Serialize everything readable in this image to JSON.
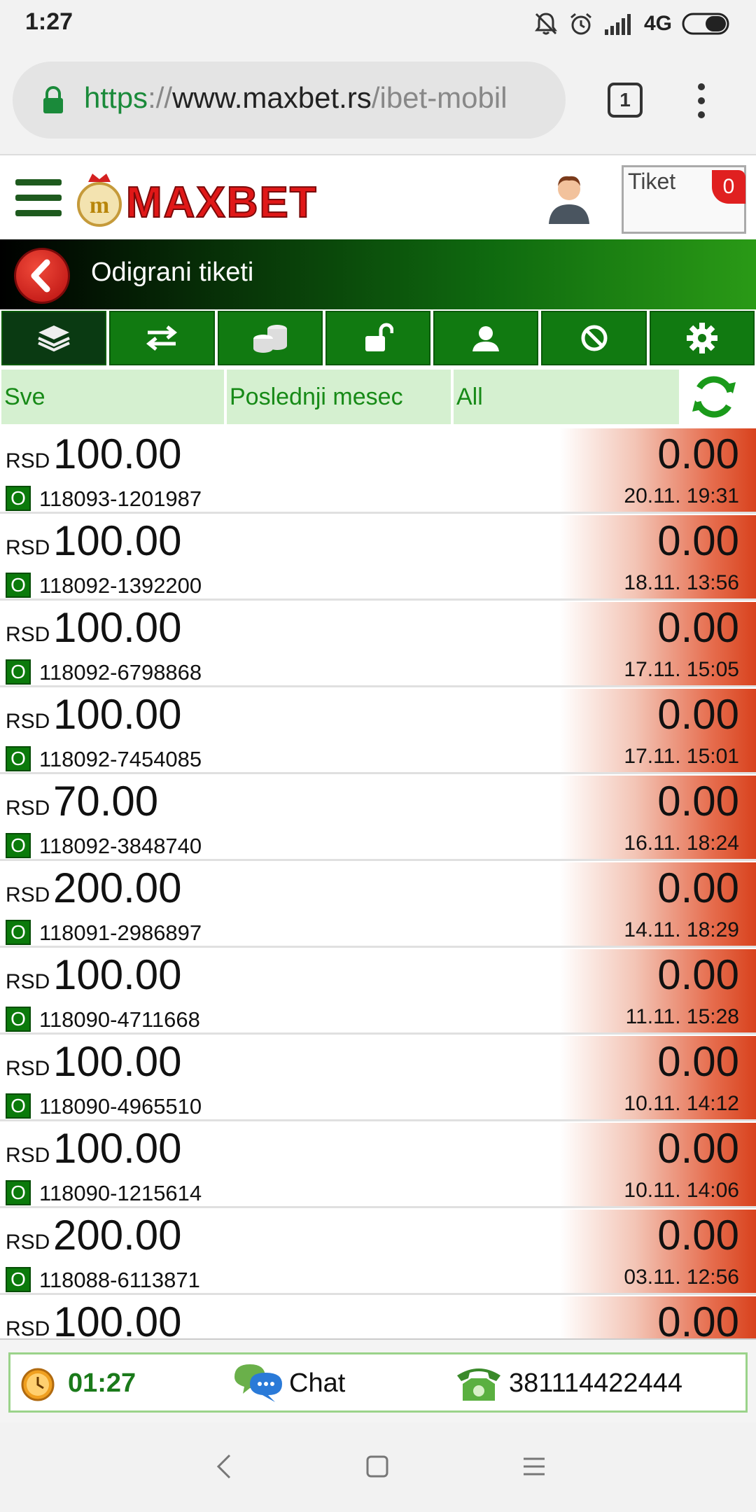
{
  "status_bar": {
    "time": "1:27",
    "network": "4G"
  },
  "browser": {
    "url_scheme": "https",
    "url_sep": "://",
    "url_host": "www.maxbet.rs",
    "url_path": "/ibet-mobil",
    "tab_count": "1"
  },
  "header": {
    "brand": "MAXBET",
    "ticket_label": "Tiket",
    "ticket_count": "0"
  },
  "page": {
    "title": "Odigrani tiketi"
  },
  "toolbar": {
    "items": [
      "layers-icon",
      "transfer-icon",
      "coins-icon",
      "unlock-icon",
      "user-icon",
      "block-icon",
      "gear-icon"
    ],
    "active_index": 0
  },
  "filters": {
    "status": "Sve",
    "period": "Poslednji mesec",
    "type": "All"
  },
  "tickets": [
    {
      "currency": "RSD",
      "amount": "100.00",
      "status": "O",
      "id": "118093-1201987",
      "payout": "0.00",
      "date": "20.11. 19:31"
    },
    {
      "currency": "RSD",
      "amount": "100.00",
      "status": "O",
      "id": "118092-1392200",
      "payout": "0.00",
      "date": "18.11. 13:56"
    },
    {
      "currency": "RSD",
      "amount": "100.00",
      "status": "O",
      "id": "118092-6798868",
      "payout": "0.00",
      "date": "17.11. 15:05"
    },
    {
      "currency": "RSD",
      "amount": "100.00",
      "status": "O",
      "id": "118092-7454085",
      "payout": "0.00",
      "date": "17.11. 15:01"
    },
    {
      "currency": "RSD",
      "amount": "70.00",
      "status": "O",
      "id": "118092-3848740",
      "payout": "0.00",
      "date": "16.11. 18:24"
    },
    {
      "currency": "RSD",
      "amount": "200.00",
      "status": "O",
      "id": "118091-2986897",
      "payout": "0.00",
      "date": "14.11. 18:29"
    },
    {
      "currency": "RSD",
      "amount": "100.00",
      "status": "O",
      "id": "118090-4711668",
      "payout": "0.00",
      "date": "11.11. 15:28"
    },
    {
      "currency": "RSD",
      "amount": "100.00",
      "status": "O",
      "id": "118090-4965510",
      "payout": "0.00",
      "date": "10.11. 14:12"
    },
    {
      "currency": "RSD",
      "amount": "100.00",
      "status": "O",
      "id": "118090-1215614",
      "payout": "0.00",
      "date": "10.11. 14:06"
    },
    {
      "currency": "RSD",
      "amount": "200.00",
      "status": "O",
      "id": "118088-6113871",
      "payout": "0.00",
      "date": "03.11. 12:56"
    },
    {
      "currency": "RSD",
      "amount": "100.00",
      "status": "",
      "id": "",
      "payout": "0.00",
      "date": ""
    }
  ],
  "footer": {
    "time": "01:27",
    "chat_label": "Chat",
    "phone": "381114422444"
  },
  "colors": {
    "brand_green": "#117a11",
    "brand_red": "#e02020",
    "loss_gradient_end": "#d8421d"
  }
}
